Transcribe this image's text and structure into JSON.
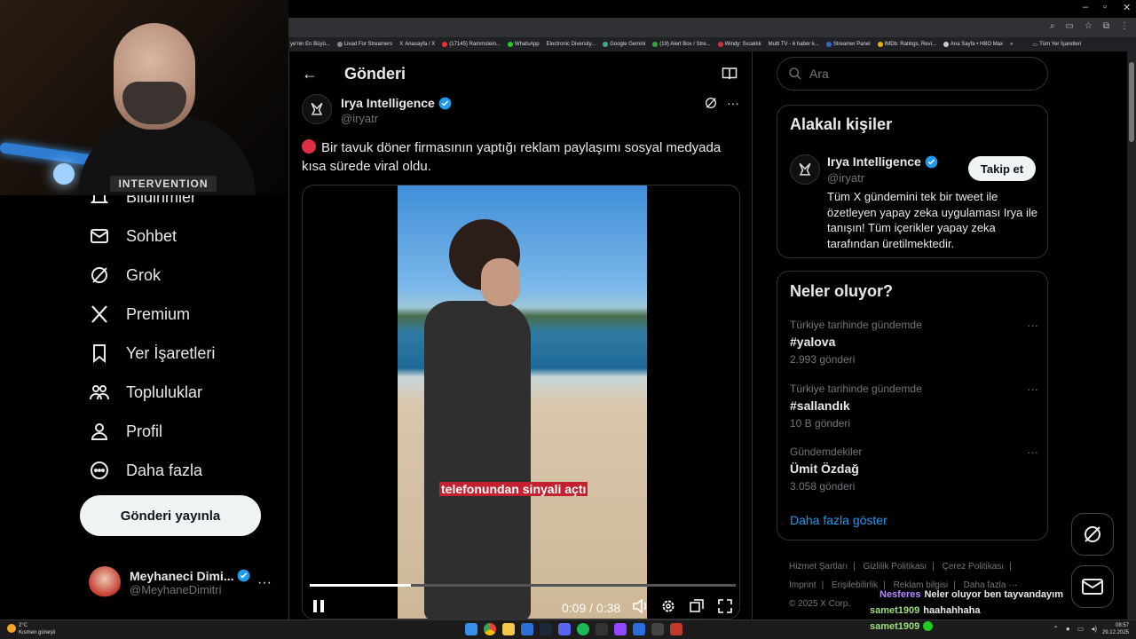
{
  "bookmarks": [
    "ye'nin En Büyü...",
    "Livad For Streamers",
    "Anasayfa / X",
    "(17145) Rammstein...",
    "WhatsApp",
    "Electronic Diversity...",
    "Google Gemini",
    "(19) Alert Box / Stre...",
    "Windy: Sıcaklık",
    "Multi TV - 6 haber k...",
    "Streamer Panel",
    "IMDb: Ratings, Revi...",
    "Ana Sayfa • HBO Max",
    "»",
    "Tüm Yer İşaretleri"
  ],
  "webcam": {
    "shirt_text": "INTERVENTION"
  },
  "nav": {
    "notifications": "Bildirimler",
    "messages": "Sohbet",
    "grok": "Grok",
    "premium": "Premium",
    "bookmarks": "Yer İşaretleri",
    "communities": "Topluluklar",
    "profile": "Profil",
    "more": "Daha fazla",
    "post_button": "Gönderi yayınla"
  },
  "account": {
    "name": "Meyhaneci Dimi...",
    "handle": "@MeyhaneDimitri",
    "more": "···"
  },
  "main": {
    "title": "Gönderi",
    "author_name": "Irya Intelligence",
    "author_handle": "@iryatr",
    "more": "···",
    "tweet_text": "Bir tavuk döner firmasının yaptığı reklam paylaşımı sosyal medyada kısa sürede viral oldu.",
    "video_caption": "telefonundan sinyali açtı",
    "video_time": "0:09 / 0:38",
    "video_progress": 0.237
  },
  "search": {
    "placeholder": "Ara"
  },
  "related": {
    "title": "Alakalı kişiler",
    "name": "Irya Intelligence",
    "handle": "@iryatr",
    "follow": "Takip et",
    "bio": "Tüm X gündemini tek bir tweet ile özetleyen yapay zeka uygulaması Irya ile tanışın! Tüm içerikler yapay zeka tarafından üretilmektedir."
  },
  "trends": {
    "title": "Neler oluyor?",
    "items": [
      {
        "meta": "Türkiye tarihinde gündemde",
        "name": "#yalova",
        "count": "2.993 gönderi"
      },
      {
        "meta": "Türkiye tarihinde gündemde",
        "name": "#sallandık",
        "count": "10 B gönderi"
      },
      {
        "meta": "Gündemdekiler",
        "name": "Ümit Özdağ",
        "count": "3.058 gönderi"
      }
    ],
    "more_icon": "···",
    "show_more": "Daha fazla göster"
  },
  "footer": {
    "links": [
      "Hizmet Şartları",
      "|",
      "Gizlilik Politikası",
      "|",
      "Çerez Politikası",
      "|",
      "Imprint",
      "|",
      "Erişilebilirlik",
      "|",
      "Reklam bilgisi",
      "|",
      "Daha fazla ···"
    ],
    "copyright": "© 2025 X Corp."
  },
  "chat": [
    {
      "user": "Nesferes",
      "message": "Neler oluyor ben tayvandayım"
    },
    {
      "user": "samet1909",
      "message": "haahahhaha"
    },
    {
      "user": "samet1909",
      "message": ""
    }
  ],
  "taskbar": {
    "weather_temp": "2°C",
    "weather_text": "Kısmen güneşli",
    "time": "08:57",
    "date": "29.12.2025"
  },
  "colors": {
    "accent": "#1d9bf0",
    "background": "#000000",
    "border": "#2f3336",
    "muted": "#71767b",
    "live_red": "#dd2e44"
  }
}
